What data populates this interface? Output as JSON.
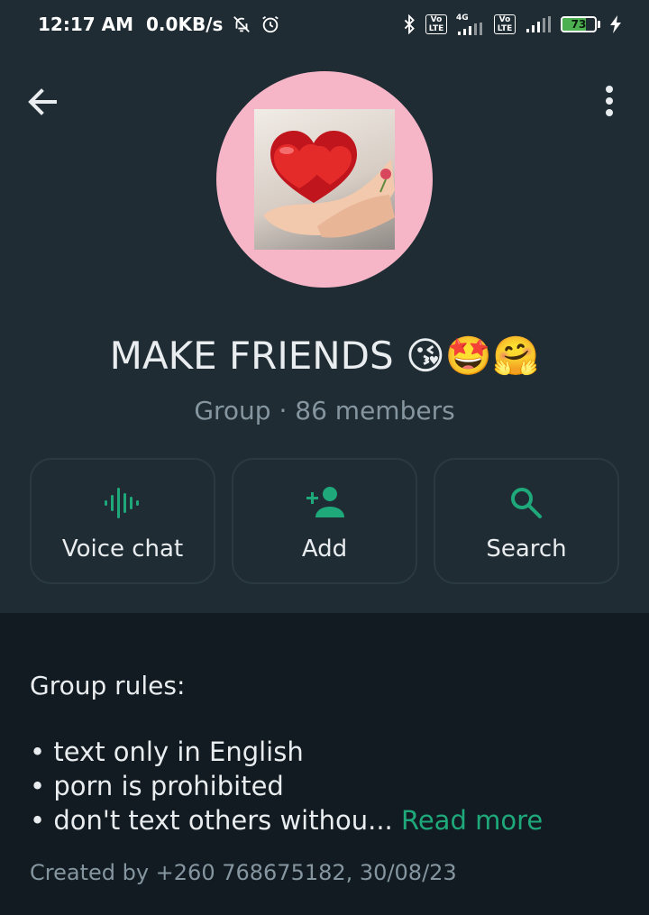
{
  "status_bar": {
    "time": "12:17 AM",
    "net_speed": "0.0KB/s",
    "network_1": "Vo LTE",
    "network_type": "4G",
    "network_2": "Vo LTE",
    "battery_level": "73",
    "icons": [
      "mute-bell-icon",
      "alarm-icon",
      "bluetooth-icon",
      "signal-icon",
      "battery-icon",
      "charging-icon"
    ]
  },
  "header": {
    "back_icon": "arrow-left-icon",
    "menu_icon": "more-vertical-icon",
    "avatar_bg": "#f7b6c8",
    "group_name": "MAKE FRIENDS 😘🤩🤗",
    "group_info": "Group · 86 members"
  },
  "actions": [
    {
      "label": "Voice chat",
      "icon": "voice-wave-icon"
    },
    {
      "label": "Add",
      "icon": "add-person-icon"
    },
    {
      "label": "Search",
      "icon": "search-icon"
    }
  ],
  "description": {
    "title": "Group rules:",
    "rules": [
      "• text only in English",
      "• porn is prohibited",
      "• don't text others withou..."
    ],
    "read_more": "Read more",
    "created": "Created by +260 768675182, 30/08/23"
  },
  "colors": {
    "accent": "#1fa97b",
    "header_bg": "#1f2c34",
    "body_bg": "#111b21",
    "muted_text": "#8696a0"
  }
}
